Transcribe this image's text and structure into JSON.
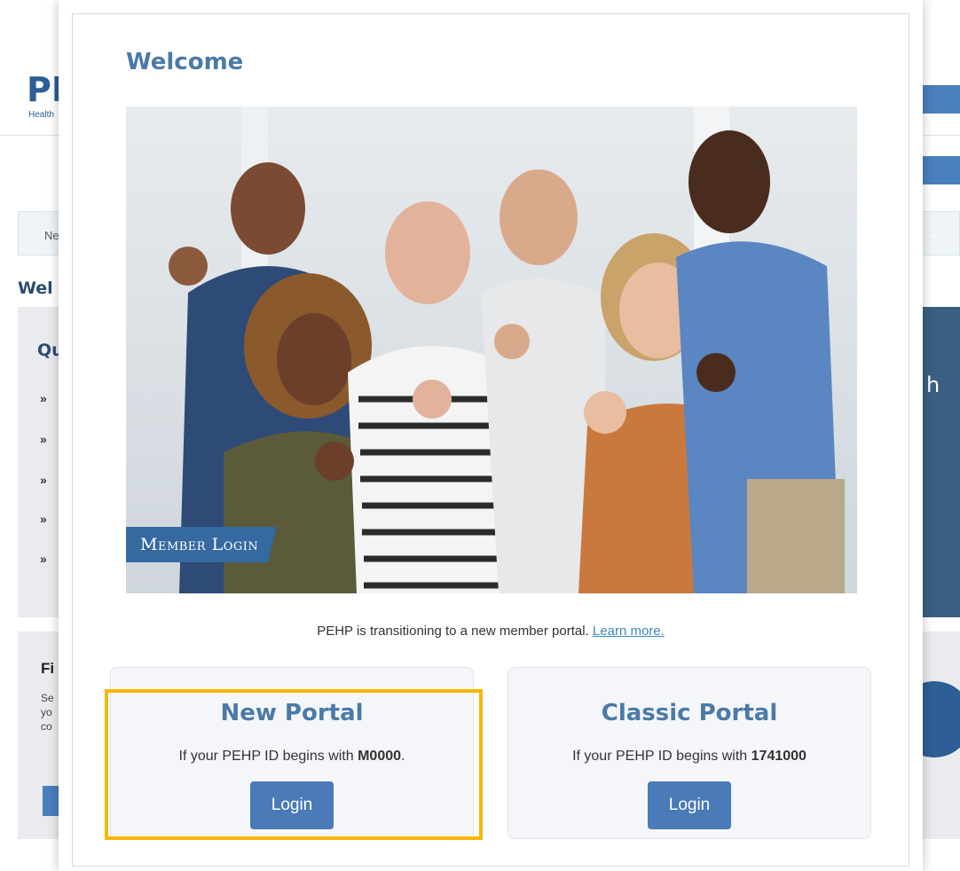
{
  "background": {
    "logo_text": "PEHP",
    "logo_sub": "Health & Benefits",
    "alert_text": "New",
    "alert_close": "×",
    "welcome": "Welcome",
    "panel_title": "Quick Links",
    "bullet": "»",
    "right_panel_text": "h",
    "bottom_title": "Find",
    "bottom_lines": [
      "Sea",
      "you",
      "cos"
    ]
  },
  "modal": {
    "title": "Welcome",
    "badge": "Member Login",
    "notice_text": "PEHP is transitioning to a new member portal.",
    "notice_link": "Learn more.",
    "cards": [
      {
        "title": "New Portal",
        "desc_prefix": "If your PEHP ID begins with",
        "id_value": "M0000",
        "desc_suffix": ".",
        "button": "Login"
      },
      {
        "title": "Classic Portal",
        "desc_prefix": "If your PEHP ID begins with",
        "id_value": "1741000",
        "desc_suffix": "",
        "button": "Login"
      }
    ]
  },
  "colors": {
    "accent": "#4a7aa8",
    "button": "#4a7ab8",
    "highlight": "#f8b704",
    "badge": "#3569a0"
  }
}
